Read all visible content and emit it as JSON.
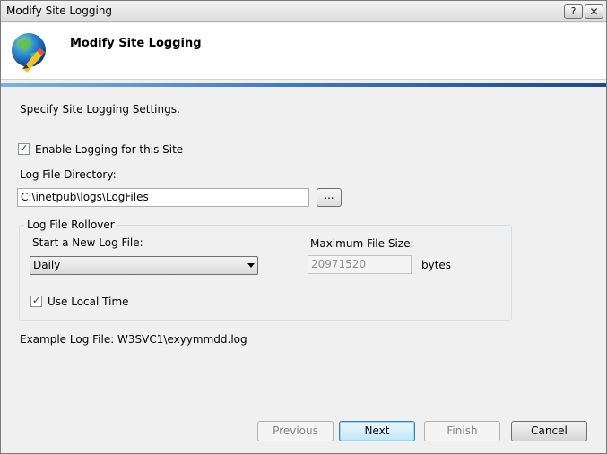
{
  "window": {
    "title": "Modify Site Logging",
    "help_symbol": "?",
    "close_symbol": "✕"
  },
  "header": {
    "title": "Modify Site Logging",
    "icon": "globe-pencil-icon"
  },
  "body": {
    "intro": "Specify Site Logging Settings.",
    "enable_logging": {
      "label": "Enable Logging for this Site",
      "checked": true
    },
    "log_dir_label": "Log File Directory:",
    "log_dir_value": "C:\\inetpub\\logs\\LogFiles",
    "browse_label": "...",
    "rollover": {
      "legend": "Log File Rollover",
      "start_label": "Start a New Log File:",
      "start_value": "Daily",
      "max_size_label": "Maximum File Size:",
      "max_size_value": "20971520",
      "bytes_label": "bytes",
      "local_time": {
        "label": "Use Local Time",
        "checked": true
      }
    },
    "example": "Example Log File: W3SVC1\\exyymmdd.log"
  },
  "buttons": {
    "previous": "Previous",
    "next": "Next",
    "finish": "Finish",
    "cancel": "Cancel"
  },
  "colors": {
    "accent_line": "#3d78b8",
    "default_button": "#bee6fd"
  }
}
